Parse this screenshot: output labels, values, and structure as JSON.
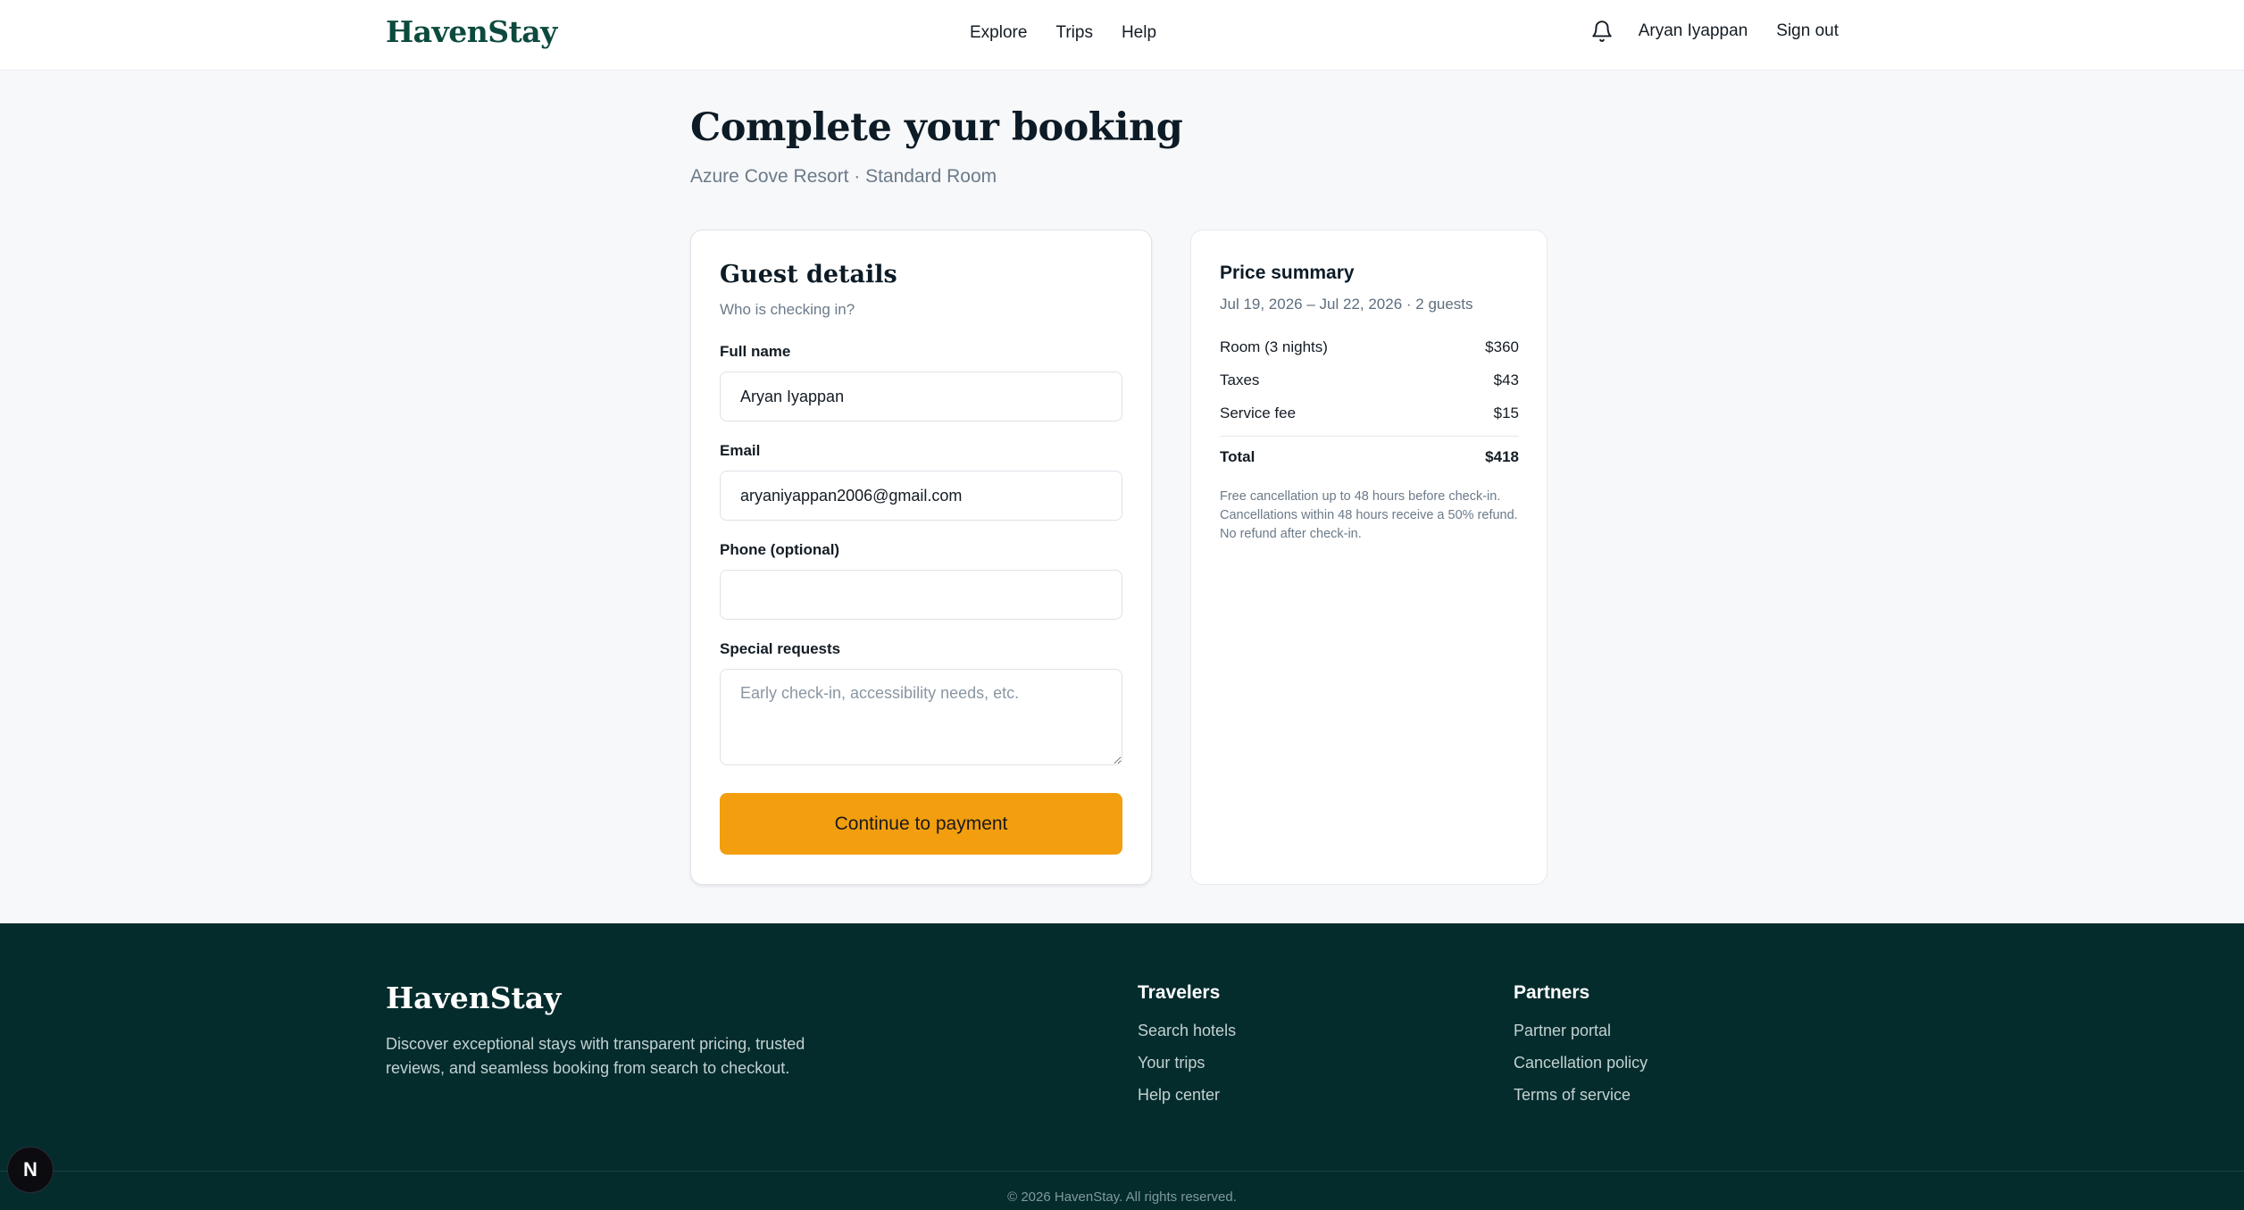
{
  "header": {
    "logo": "HavenStay",
    "nav": [
      "Explore",
      "Trips",
      "Help"
    ],
    "user_name": "Aryan Iyappan",
    "sign_out": "Sign out"
  },
  "page": {
    "title": "Complete your booking",
    "subtitle": "Azure Cove Resort · Standard Room"
  },
  "guest_form": {
    "heading": "Guest details",
    "subheading": "Who is checking in?",
    "full_name_label": "Full name",
    "full_name_value": "Aryan Iyappan",
    "email_label": "Email",
    "email_value": "aryaniyappan2006@gmail.com",
    "phone_label": "Phone (optional)",
    "phone_value": "",
    "requests_label": "Special requests",
    "requests_placeholder": "Early check-in, accessibility needs, etc.",
    "submit_label": "Continue to payment"
  },
  "price_summary": {
    "title": "Price summary",
    "dates": "Jul 19, 2026 – Jul 22, 2026 · 2 guests",
    "rows": [
      {
        "label": "Room (3 nights)",
        "amount": "$360"
      },
      {
        "label": "Taxes",
        "amount": "$43"
      },
      {
        "label": "Service fee",
        "amount": "$15"
      }
    ],
    "total_label": "Total",
    "total_amount": "$418",
    "policy": "Free cancellation up to 48 hours before check-in. Cancellations within 48 hours receive a 50% refund. No refund after check-in."
  },
  "footer": {
    "logo": "HavenStay",
    "description": "Discover exceptional stays with transparent pricing, trusted reviews, and seamless booking from search to checkout.",
    "travelers": {
      "title": "Travelers",
      "links": [
        "Search hotels",
        "Your trips",
        "Help center"
      ]
    },
    "partners": {
      "title": "Partners",
      "links": [
        "Partner portal",
        "Cancellation policy",
        "Terms of service"
      ]
    },
    "copyright": "© 2026 HavenStay. All rights reserved."
  },
  "badge": "N",
  "colors": {
    "brand": "#0d4a3e",
    "accent": "#f29e0f",
    "footer_bg": "#052c2d"
  }
}
